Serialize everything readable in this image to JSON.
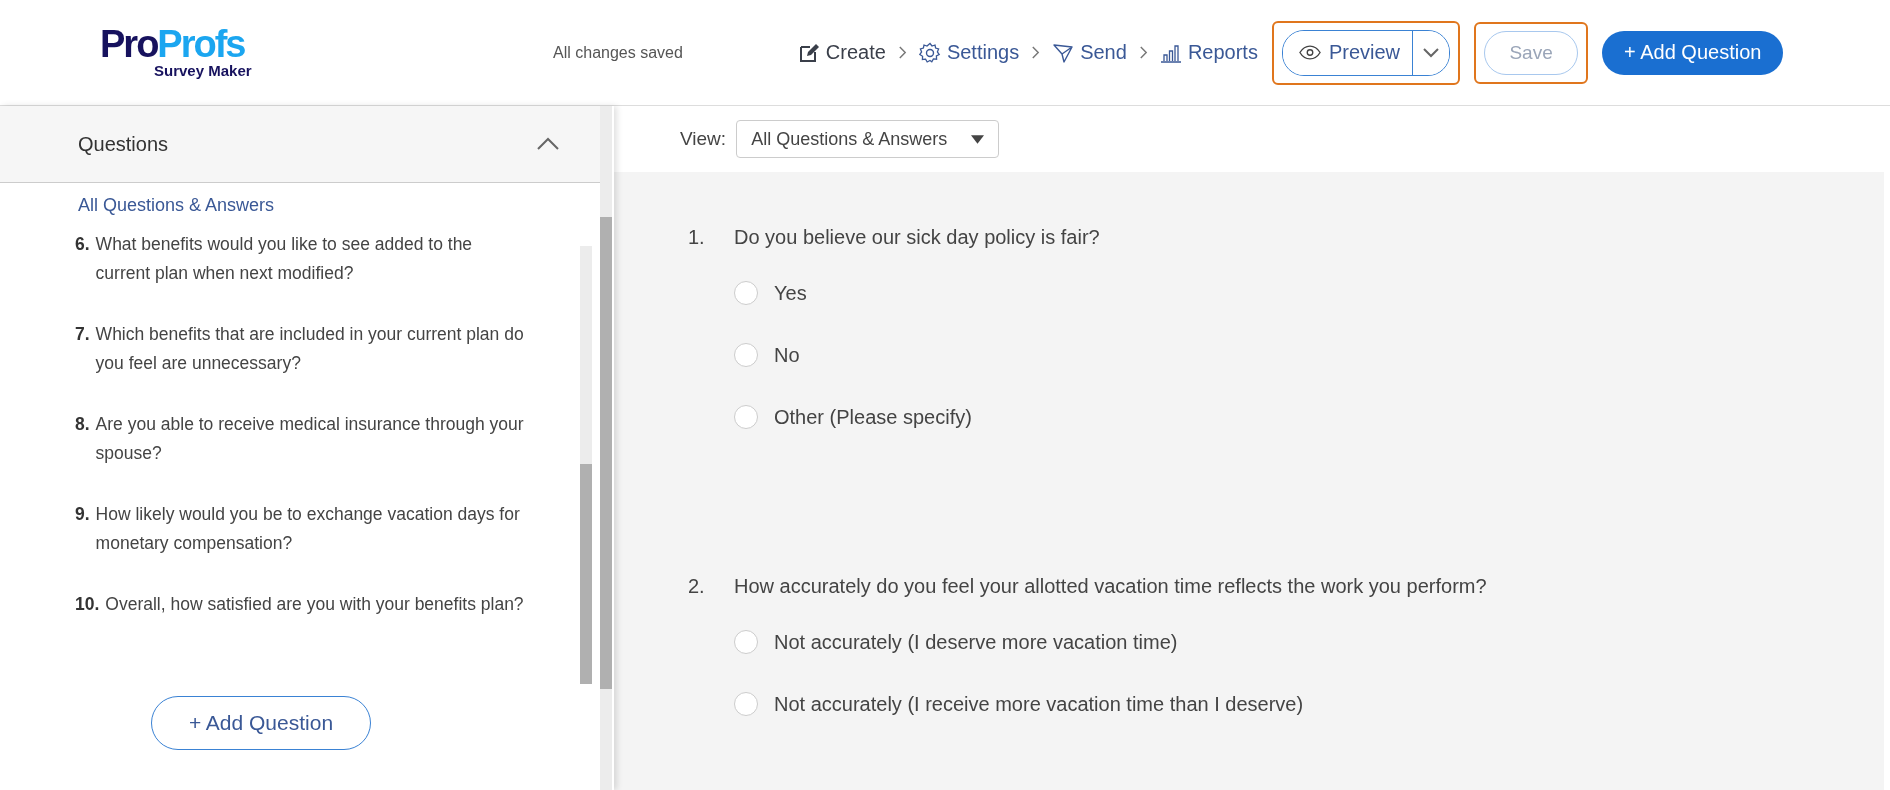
{
  "header": {
    "logo": {
      "part_1": "Pro",
      "part_2": "Profs",
      "subtitle": "Survey Maker"
    },
    "status": "All changes saved",
    "steps": [
      {
        "kind": "create",
        "label": "Create",
        "selected": true
      },
      {
        "kind": "settings",
        "label": "Settings",
        "selected": false
      },
      {
        "kind": "send",
        "label": "Send",
        "selected": false
      },
      {
        "kind": "reports",
        "label": "Reports",
        "selected": false
      }
    ],
    "preview_button": "Preview",
    "save_button": {
      "label": "Save",
      "disabled": true
    },
    "add_button": "+ Add Question"
  },
  "sidebar": {
    "title": "Questions",
    "expanded": true,
    "filter_link": "All Questions & Answers",
    "questions": [
      {
        "number": "6.",
        "text": "What benefits would you like to see added to the current plan when next modified?"
      },
      {
        "number": "7.",
        "text": "Which benefits that are included in your current plan do you feel are unnecessary?"
      },
      {
        "number": "8.",
        "text": "Are you able to receive medical insurance through your spouse?"
      },
      {
        "number": "9.",
        "text": "How likely would you be to exchange vacation days for monetary compensation?"
      },
      {
        "number": "10.",
        "text": "Overall, how satisfied are you with your benefits plan?"
      }
    ],
    "add_button": "+ Add Question"
  },
  "main": {
    "view_label": "View:",
    "view_select": "All Questions & Answers",
    "questions": [
      {
        "number": "1.",
        "text": "Do you believe our sick day policy is fair?",
        "options": [
          {
            "label": "Yes",
            "selected": false
          },
          {
            "label": "No",
            "selected": false
          },
          {
            "label": "Other (Please specify)",
            "selected": false
          }
        ]
      },
      {
        "number": "2.",
        "text": "How accurately do you feel your allotted vacation time reflects the work you perform?",
        "options": [
          {
            "label": "Not accurately (I deserve more vacation time)",
            "selected": false
          },
          {
            "label": "Not accurately (I receive more vacation time than I deserve)",
            "selected": false
          }
        ]
      }
    ]
  }
}
